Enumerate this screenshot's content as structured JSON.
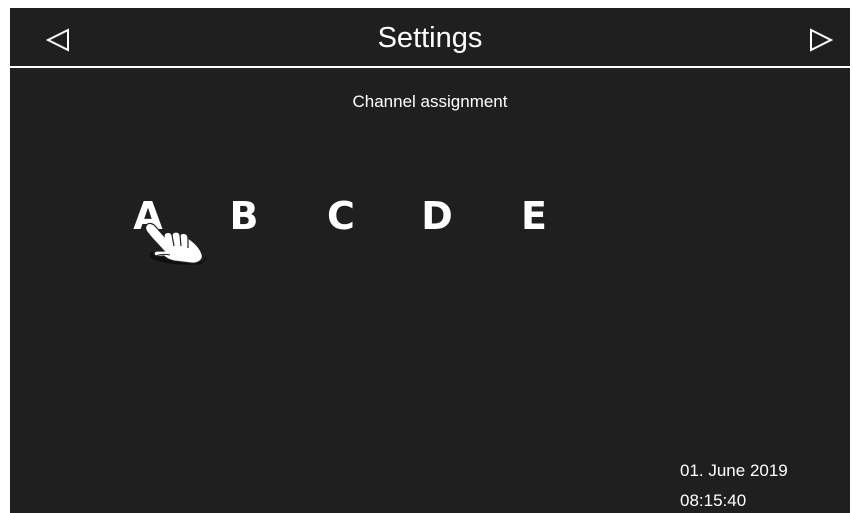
{
  "header": {
    "title": "Settings",
    "prev_icon": "triangle-left-icon",
    "next_icon": "triangle-right-icon"
  },
  "main": {
    "subtitle": "Channel assignment",
    "channels": [
      "A",
      "B",
      "C",
      "D",
      "E"
    ],
    "pointer_icon": "hand-pointer-icon"
  },
  "status": {
    "date": "01. June 2019",
    "time": "08:15:40"
  },
  "colors": {
    "background": "#1f1f1f",
    "foreground": "#ffffff"
  }
}
